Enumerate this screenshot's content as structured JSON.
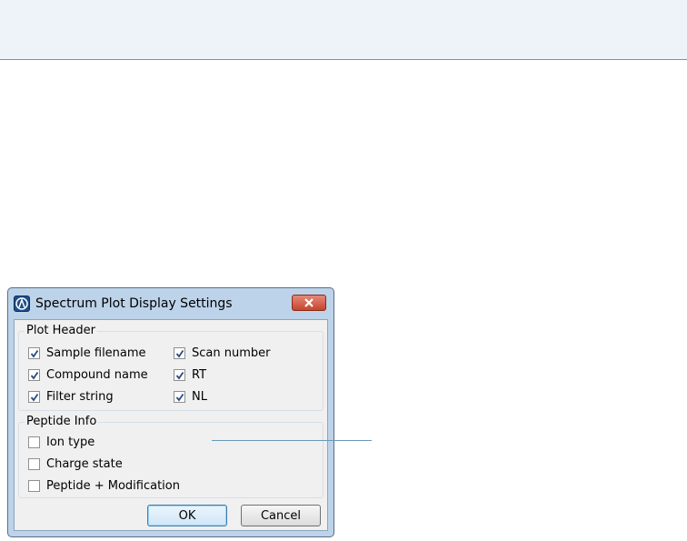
{
  "dialog": {
    "title": "Spectrum Plot Display Settings",
    "plot_header": {
      "label": "Plot Header",
      "items": [
        {
          "label": "Sample filename",
          "checked": true
        },
        {
          "label": "Scan number",
          "checked": true
        },
        {
          "label": "Compound name",
          "checked": true
        },
        {
          "label": "RT",
          "checked": true
        },
        {
          "label": "Filter string",
          "checked": true
        },
        {
          "label": "NL",
          "checked": true
        }
      ]
    },
    "peptide_info": {
      "label": "Peptide Info",
      "items": [
        {
          "label": "Ion type",
          "checked": false
        },
        {
          "label": "Charge state",
          "checked": false
        },
        {
          "label": "Peptide + Modification",
          "checked": false
        }
      ]
    },
    "buttons": {
      "ok": "OK",
      "cancel": "Cancel"
    }
  }
}
